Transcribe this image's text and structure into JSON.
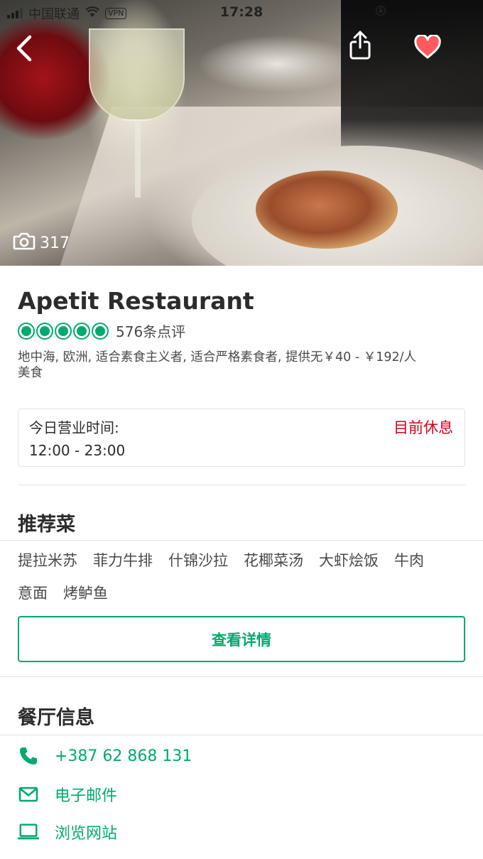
{
  "status_bar": {
    "carrier": "中国联通",
    "vpn": "VPN",
    "time": "17:28"
  },
  "hero": {
    "photo_count": "317",
    "icons": [
      "back-arrow-icon",
      "share-icon",
      "heart-icon",
      "camera-icon"
    ]
  },
  "restaurant": {
    "name": "Apetit Restaurant",
    "rating_bubbles": 5,
    "review_count": "576条点评",
    "cuisines_line1": "地中海, 欧洲, 适合素食主义者, 适合严格素食者, 提供无￥40 - ￥192/人",
    "cuisines_line2": "美食"
  },
  "hours": {
    "label": "今日营业时间:",
    "value": "12:00 - 23:00",
    "status": "目前休息"
  },
  "recommended": {
    "title": "推荐菜",
    "dishes": [
      "提拉米苏",
      "菲力牛排",
      "什锦沙拉",
      "花椰菜汤",
      "大虾烩饭",
      "牛肉意面",
      "烤鲈鱼"
    ],
    "dishes_wrapped": [
      "提拉米苏",
      "菲力牛排",
      "什锦沙拉",
      "花椰菜汤",
      "大虾烩饭",
      "牛肉",
      "意面",
      "烤鲈鱼"
    ],
    "details_button": "查看详情"
  },
  "info": {
    "title": "餐厅信息",
    "phone": "+387 62 868 131",
    "email": "电子邮件",
    "website": "浏览网站"
  },
  "colors": {
    "accent": "#00aa6c",
    "closed": "#d0021b",
    "heart": "#ff5a5f"
  }
}
